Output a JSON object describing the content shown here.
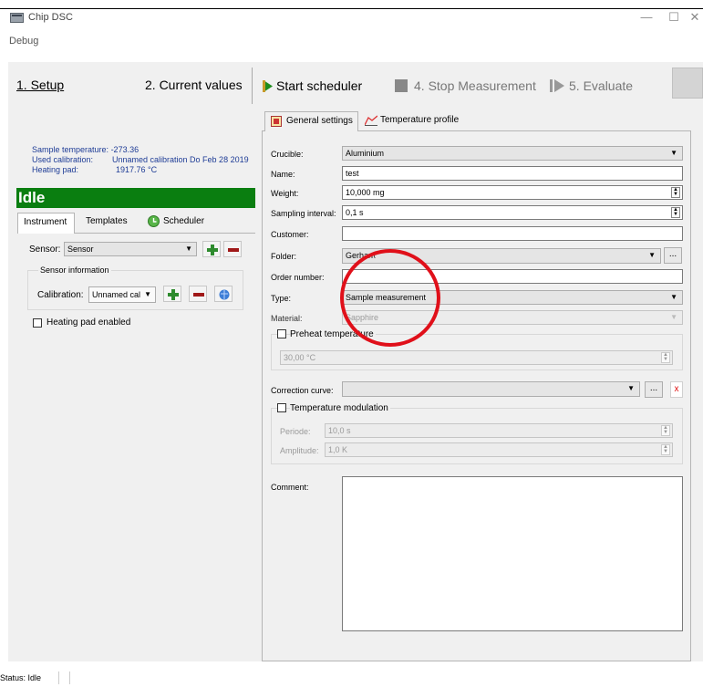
{
  "window": {
    "title": "Chip DSC",
    "minimize": "—",
    "maximize": "☐",
    "close": "✕"
  },
  "menu": {
    "debug": "Debug"
  },
  "toolbar": {
    "setup": "1. Setup",
    "current_values": "2. Current values",
    "start_scheduler": "Start scheduler",
    "stop_measurement": "4. Stop  Measurement",
    "evaluate": "5. Evaluate"
  },
  "info": {
    "sample_temp_label": "Sample temperature:",
    "sample_temp_value": "-273.36",
    "used_calib_label": "Used calibration:",
    "used_calib_value": "Unnamed calibration Do Feb 28 2019",
    "heating_pad_label": "Heating pad:",
    "heating_pad_value": "1917.76 °C"
  },
  "state": "Idle",
  "left_tabs": {
    "instrument": "Instrument",
    "templates": "Templates",
    "scheduler": "Scheduler"
  },
  "sensor": {
    "label": "Sensor:",
    "value": "Sensor",
    "group_title": "Sensor information",
    "calibration_label": "Calibration:",
    "calibration_value": "Unnamed cal"
  },
  "heating_pad_enabled": "Heating pad enabled",
  "right_tabs": {
    "general": "General settings",
    "temperature_profile": "Temperature profile"
  },
  "form": {
    "crucible_label": "Crucible:",
    "crucible_value": "Aluminium",
    "name_label": "Name:",
    "name_value": "test",
    "weight_label": "Weight:",
    "weight_value": "10,000 mg",
    "sampling_label": "Sampling interval:",
    "sampling_value": "0,1 s",
    "customer_label": "Customer:",
    "customer_value": "",
    "folder_label": "Folder:",
    "folder_value": "Gerhan\\",
    "order_label": "Order number:",
    "order_value": "",
    "type_label": "Type:",
    "type_value": "Sample measurement",
    "material_label": "Material:",
    "material_value": "Sapphire",
    "preheat_label": "Preheat temperature",
    "preheat_value": "30,00 °C",
    "correction_label": "Correction curve:",
    "correction_value": "",
    "modulation_label": "Temperature modulation",
    "period_label": "Periode:",
    "period_value": "10,0 s",
    "amplitude_label": "Amplitude:",
    "amplitude_value": "1,0 K",
    "comment_label": "Comment:",
    "browse": "...",
    "clear": "x"
  },
  "status": {
    "text": "Status: Idle"
  }
}
